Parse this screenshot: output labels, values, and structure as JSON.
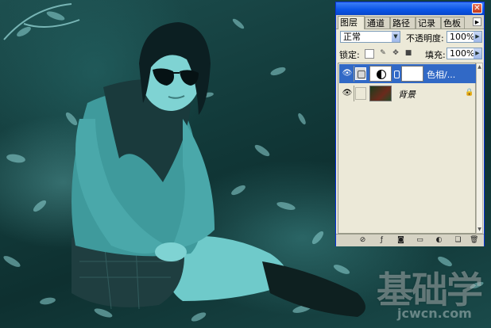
{
  "palette": {
    "tabs": [
      "图层",
      "通道",
      "路径",
      "记录",
      "色板"
    ],
    "active_tab": "图层",
    "blend_mode": "正常",
    "opacity_label": "不透明度:",
    "opacity_value": "100%",
    "lock_label": "锁定:",
    "fill_label": "填充:",
    "fill_value": "100%",
    "layers": [
      {
        "name": "色相/...",
        "selected": true
      },
      {
        "name": "背景",
        "selected": false,
        "locked": true
      }
    ],
    "icons": {
      "close": "close-icon",
      "eye": "eye-icon",
      "lock": "lock-icon",
      "link": "chain-link-icon"
    },
    "colors": {
      "titlebar": "#0a54e6",
      "selection": "#3169c6",
      "panel_bg": "#ece9d8"
    }
  },
  "watermark": {
    "main": "基础学",
    "sub": "jcwcn.com"
  }
}
